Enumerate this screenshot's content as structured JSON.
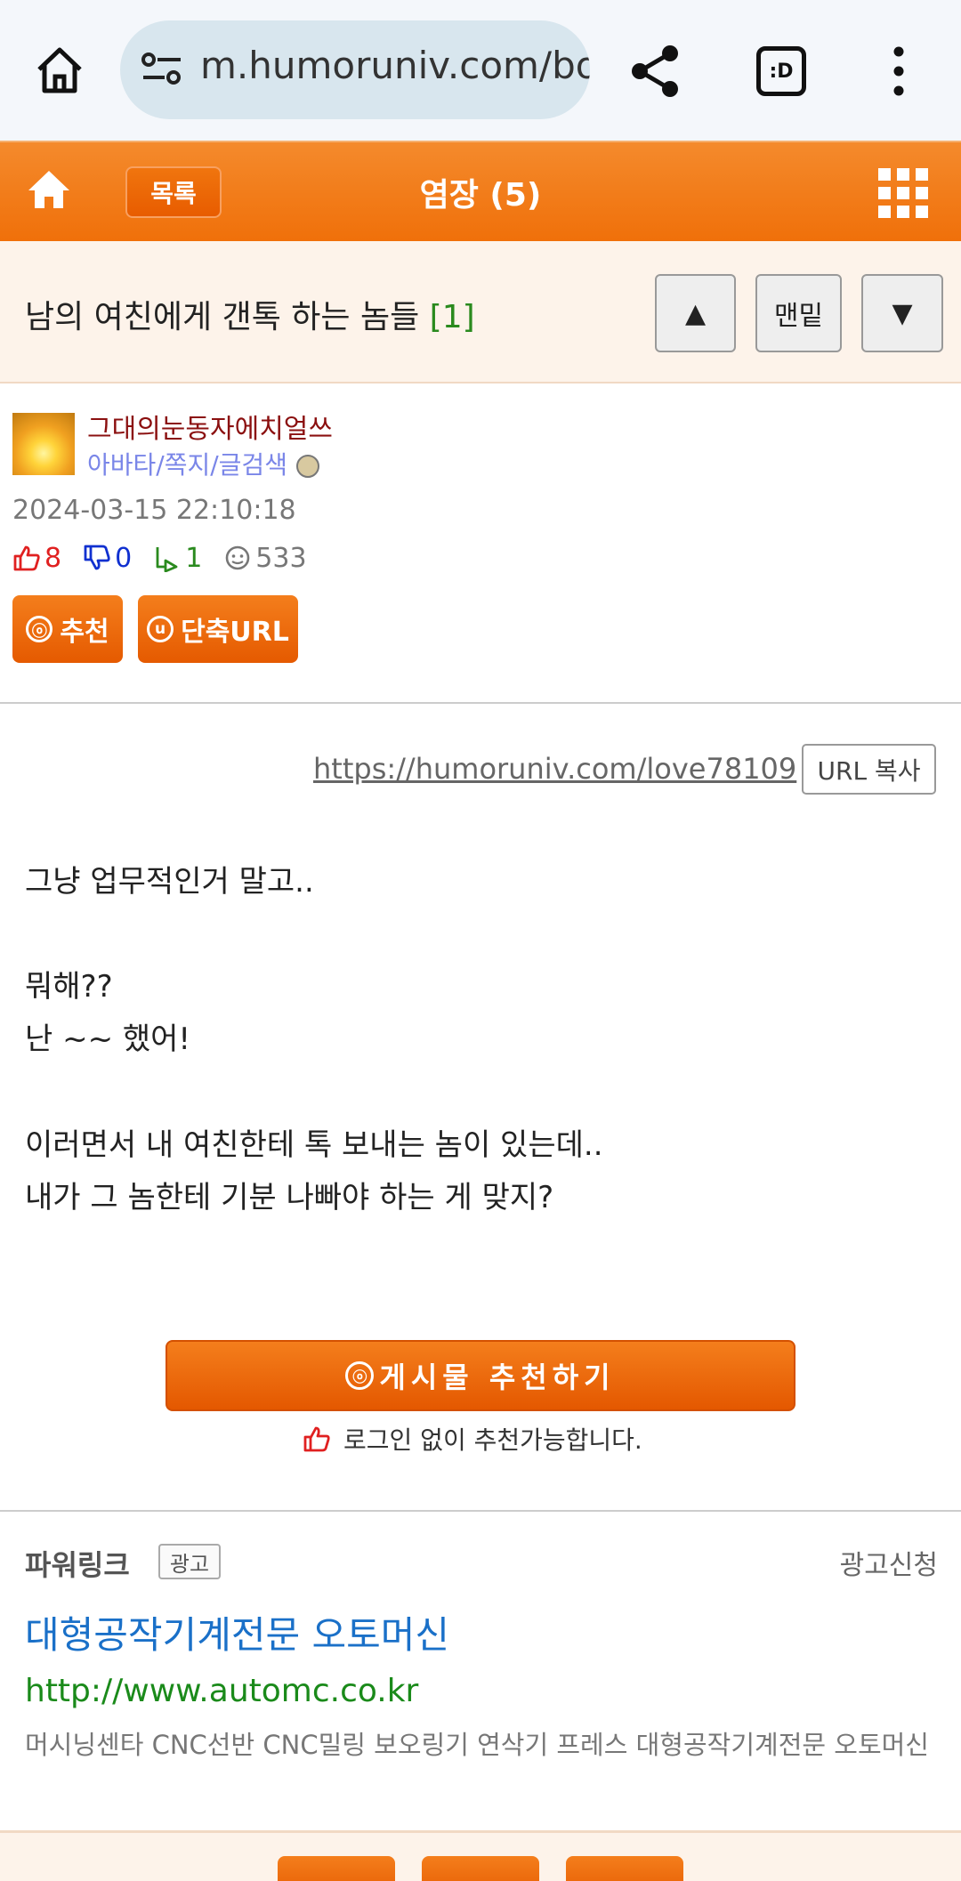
{
  "browser": {
    "url": "m.humoruniv.com/board/humor/read.html",
    "tab_label": ":D"
  },
  "app_bar": {
    "list_label": "목록",
    "title": "염장 (5)"
  },
  "post": {
    "title": "남의 여친에게 갠톡 하는 놈들",
    "comment_count": "[1]",
    "nav_up": "▲",
    "nav_bottom": "맨밑",
    "nav_down": "▼"
  },
  "author": {
    "name": "그대의눈동자에치얼쓰",
    "links": "아바타/쪽지/글검색",
    "date": "2024-03-15 22:10:18",
    "stats": {
      "likes": "8",
      "dislikes": "0",
      "replies": "1",
      "views": "533"
    },
    "recommend_label": "추천",
    "recommend_icon": "ⓞ",
    "shorturl_label": "단축URL",
    "shorturl_icon": "u"
  },
  "content": {
    "short_url": "https://humoruniv.com/love78109",
    "copy_label": "URL 복사",
    "lines": [
      "그냥 업무적인거 말고..",
      "뭐해??",
      "난 ~~ 했어!",
      "이러면서 내 여친한테 톡 보내는 놈이 있는데..",
      "내가 그 놈한테 기분 나빠야 하는 게 맞지?"
    ],
    "recommend_big_label": "게시물 추천하기",
    "no_login_note": "로그인 없이 추천가능합니다."
  },
  "ad": {
    "powerlink_label": "파워링크",
    "ad_badge": "광고",
    "apply_label": "광고신청",
    "title": "대형공작기계전문 오토머신",
    "url": "http://www.automc.co.kr",
    "description": "머시닝센타 CNC선반 CNC밀링 보오링기 연삭기 프레스 대형공작기계전문 오토머신"
  },
  "colors": {
    "accent_orange": "#f0700a",
    "title_bg": "#fdf3ea",
    "author_name": "#8b1010",
    "link_purple": "#7a86e8",
    "like_red": "#e02020",
    "dislike_blue": "#1030d0",
    "reply_green": "#2a8a1e",
    "ad_title_blue": "#1a70c8",
    "ad_url_green": "#1a8a1a"
  }
}
